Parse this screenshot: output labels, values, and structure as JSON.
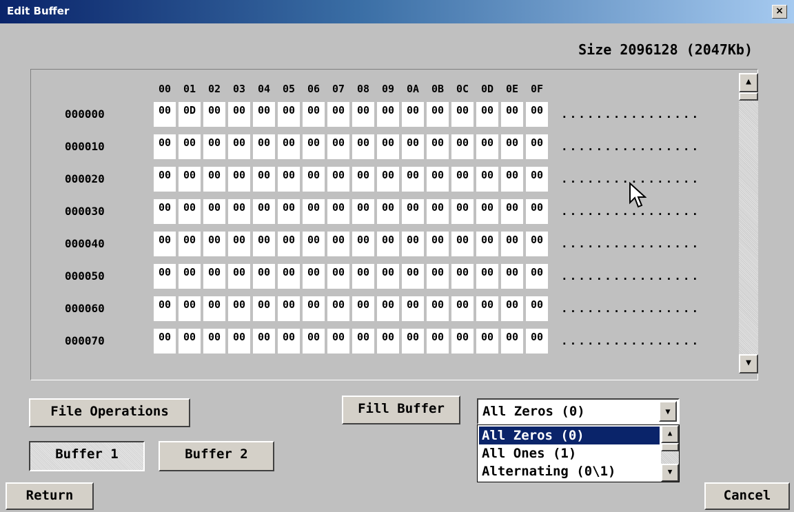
{
  "window": {
    "title": "Edit Buffer",
    "close_label": "×"
  },
  "size_label": "Size 2096128 (2047Kb)",
  "hex_grid": {
    "columns": [
      "00",
      "01",
      "02",
      "03",
      "04",
      "05",
      "06",
      "07",
      "08",
      "09",
      "0A",
      "0B",
      "0C",
      "0D",
      "0E",
      "0F"
    ],
    "rows": [
      {
        "address": "000000",
        "bytes": [
          "00",
          "0D",
          "00",
          "00",
          "00",
          "00",
          "00",
          "00",
          "00",
          "00",
          "00",
          "00",
          "00",
          "00",
          "00",
          "00"
        ],
        "ascii": "................"
      },
      {
        "address": "000010",
        "bytes": [
          "00",
          "00",
          "00",
          "00",
          "00",
          "00",
          "00",
          "00",
          "00",
          "00",
          "00",
          "00",
          "00",
          "00",
          "00",
          "00"
        ],
        "ascii": "................"
      },
      {
        "address": "000020",
        "bytes": [
          "00",
          "00",
          "00",
          "00",
          "00",
          "00",
          "00",
          "00",
          "00",
          "00",
          "00",
          "00",
          "00",
          "00",
          "00",
          "00"
        ],
        "ascii": "................"
      },
      {
        "address": "000030",
        "bytes": [
          "00",
          "00",
          "00",
          "00",
          "00",
          "00",
          "00",
          "00",
          "00",
          "00",
          "00",
          "00",
          "00",
          "00",
          "00",
          "00"
        ],
        "ascii": "................"
      },
      {
        "address": "000040",
        "bytes": [
          "00",
          "00",
          "00",
          "00",
          "00",
          "00",
          "00",
          "00",
          "00",
          "00",
          "00",
          "00",
          "00",
          "00",
          "00",
          "00"
        ],
        "ascii": "................"
      },
      {
        "address": "000050",
        "bytes": [
          "00",
          "00",
          "00",
          "00",
          "00",
          "00",
          "00",
          "00",
          "00",
          "00",
          "00",
          "00",
          "00",
          "00",
          "00",
          "00"
        ],
        "ascii": "................"
      },
      {
        "address": "000060",
        "bytes": [
          "00",
          "00",
          "00",
          "00",
          "00",
          "00",
          "00",
          "00",
          "00",
          "00",
          "00",
          "00",
          "00",
          "00",
          "00",
          "00"
        ],
        "ascii": "................"
      },
      {
        "address": "000070",
        "bytes": [
          "00",
          "00",
          "00",
          "00",
          "00",
          "00",
          "00",
          "00",
          "00",
          "00",
          "00",
          "00",
          "00",
          "00",
          "00",
          "00"
        ],
        "ascii": "................"
      }
    ]
  },
  "buttons": {
    "file_operations": "File Operations",
    "fill_buffer": "Fill Buffer",
    "buffer1": "Buffer 1",
    "buffer2": "Buffer 2",
    "return": "Return",
    "cancel": "Cancel"
  },
  "fill_select": {
    "value": "All Zeros (0)",
    "options": [
      "All Zeros (0)",
      "All Ones (1)",
      "Alternating (0\\1)"
    ],
    "selected_index": 0
  },
  "active_buffer": "Buffer 1",
  "colors": {
    "dialog_bg": "#c0c0c0",
    "title_gradient_start": "#0a246a",
    "title_gradient_end": "#a6caf0",
    "selection": "#0a246a"
  },
  "icons": {
    "close": "close-icon",
    "scroll_up": "scroll-up-arrow-icon",
    "scroll_down": "scroll-down-arrow-icon",
    "dropdown": "chevron-down-icon",
    "cursor": "mouse-pointer-icon"
  }
}
